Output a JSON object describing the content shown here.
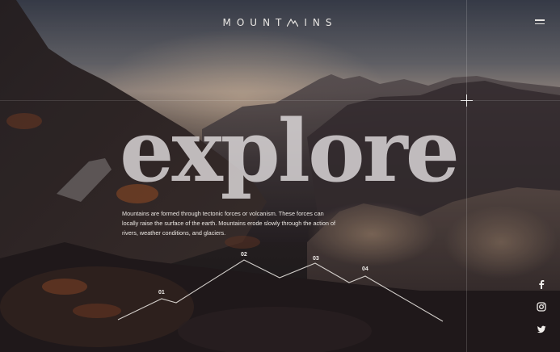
{
  "header": {
    "logo_text_left": "MOUNT",
    "logo_text_right": "INS",
    "logo_icon": "mountain-peak-icon",
    "menu_icon": "hamburger-menu-icon"
  },
  "hero": {
    "headline": "explore",
    "description": "Mountains are formed through tectonic forces or volcanism. These forces can locally raise the surface of the earth. Mountains erode slowly through the action of rivers, weather conditions, and glaciers."
  },
  "timeline": {
    "points": [
      {
        "label": "01"
      },
      {
        "label": "02"
      },
      {
        "label": "03"
      },
      {
        "label": "04"
      }
    ]
  },
  "social": [
    {
      "name": "facebook",
      "icon": "facebook-icon"
    },
    {
      "name": "instagram",
      "icon": "instagram-icon"
    },
    {
      "name": "twitter",
      "icon": "twitter-icon"
    }
  ],
  "colors": {
    "text": "#e9e6e3",
    "sky_glow": "#e6c8aa",
    "rock_dark": "#1c1718",
    "foliage": "#8a4a2a"
  }
}
